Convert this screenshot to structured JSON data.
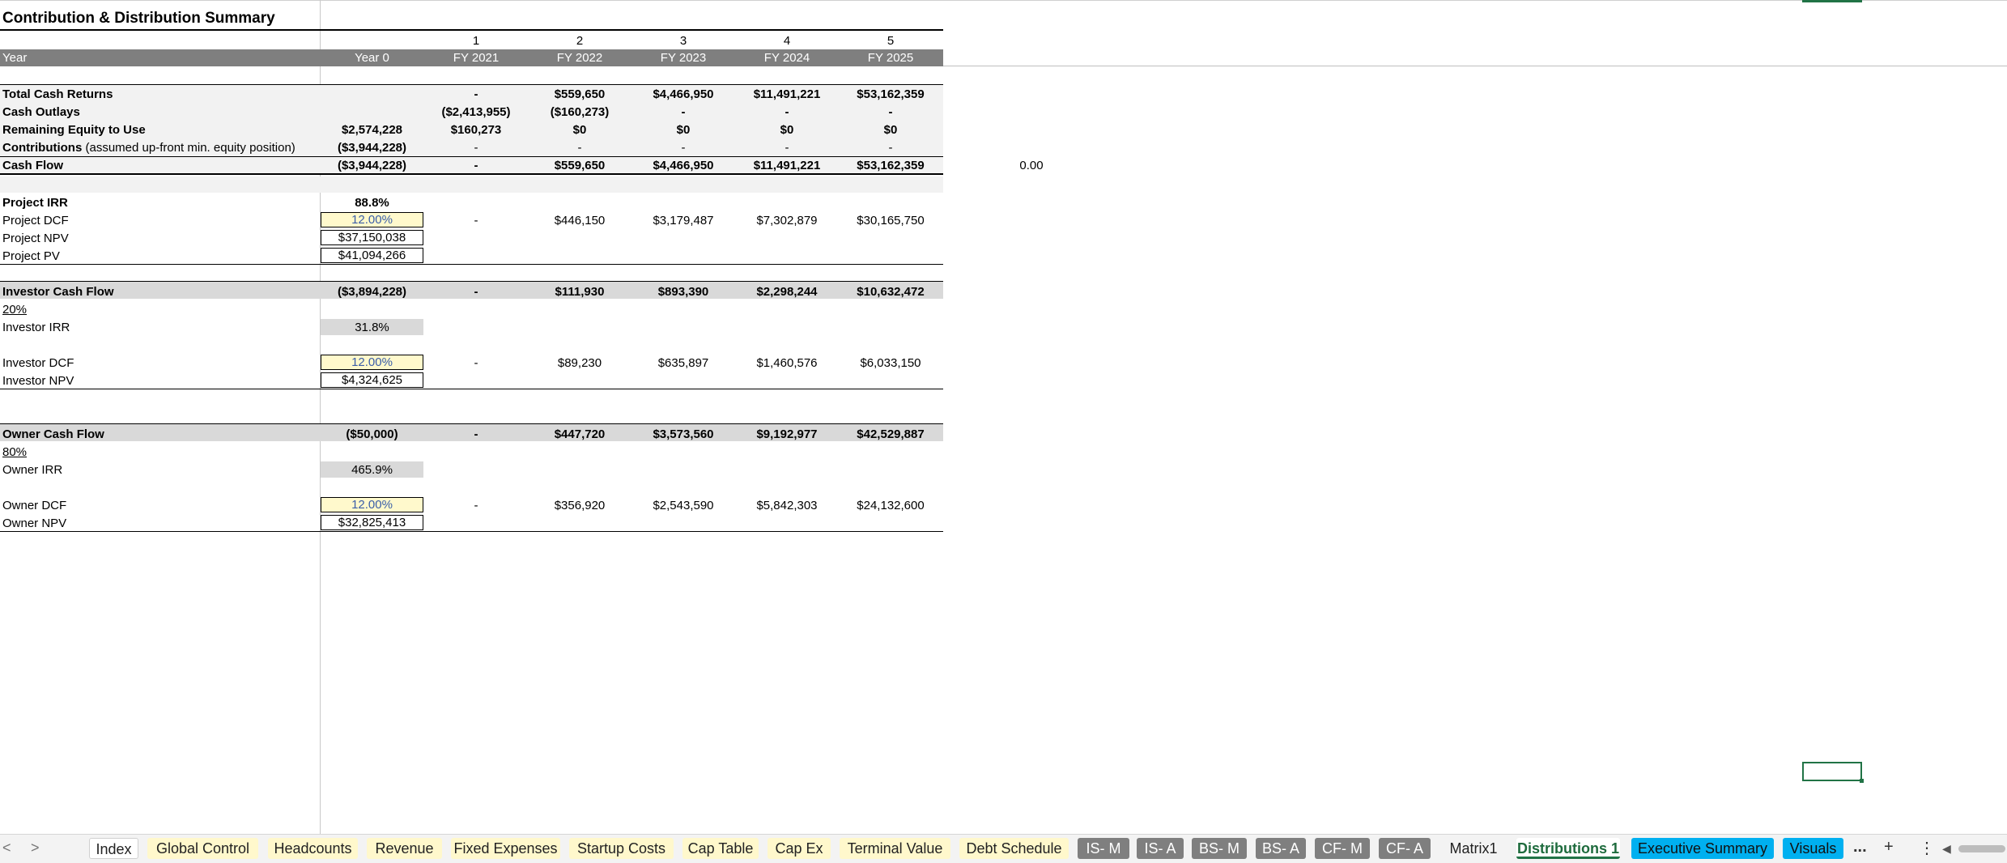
{
  "sheet": {
    "title": "Contribution & Distribution Summary",
    "period_numbers": [
      "1",
      "2",
      "3",
      "4",
      "5"
    ],
    "year_row": {
      "label": "Year",
      "values": [
        "Year 0",
        "FY 2021",
        "FY 2022",
        "FY 2023",
        "FY 2024",
        "FY 2025"
      ]
    },
    "summary_rows": [
      {
        "label": "Total Cash Returns",
        "values": [
          "",
          "-",
          "$559,650",
          "$4,466,950",
          "$11,491,221",
          "$53,162,359"
        ]
      },
      {
        "label": "Cash Outlays",
        "values": [
          "",
          "($2,413,955)",
          "($160,273)",
          "-",
          "-",
          "-"
        ]
      },
      {
        "label": "Remaining Equity to Use",
        "values": [
          "$2,574,228",
          "$160,273",
          "$0",
          "$0",
          "$0",
          "$0"
        ]
      },
      {
        "label": "Contributions",
        "label_suffix": " (assumed up-front min. equity position)",
        "values": [
          "($3,944,228)",
          "-",
          "-",
          "-",
          "-",
          "-"
        ]
      },
      {
        "label": "Cash Flow",
        "values": [
          "($3,944,228)",
          "-",
          "$559,650",
          "$4,466,950",
          "$11,491,221",
          "$53,162,359"
        ],
        "extra": "0.00"
      }
    ],
    "project": {
      "irr_label": "Project IRR",
      "irr": "88.8%",
      "dcf_label": "Project DCF",
      "dcf_rate": "12.00%",
      "dcf_values": [
        "-",
        "$446,150",
        "$3,179,487",
        "$7,302,879",
        "$30,165,750"
      ],
      "npv_label": "Project NPV",
      "npv": "$37,150,038",
      "pv_label": "Project PV",
      "pv": "$41,094,266"
    },
    "investor": {
      "cf_label": "Investor Cash Flow",
      "cf_values": [
        "($3,894,228)",
        "-",
        "$111,930",
        "$893,390",
        "$2,298,244",
        "$10,632,472"
      ],
      "share": "20%",
      "irr_label": "Investor IRR",
      "irr": "31.8%",
      "dcf_label": "Investor DCF",
      "dcf_rate": "12.00%",
      "dcf_values": [
        "-",
        "$89,230",
        "$635,897",
        "$1,460,576",
        "$6,033,150"
      ],
      "npv_label": "Investor NPV",
      "npv": "$4,324,625"
    },
    "owner": {
      "cf_label": "Owner Cash Flow",
      "cf_values": [
        "($50,000)",
        "-",
        "$447,720",
        "$3,573,560",
        "$9,192,977",
        "$42,529,887"
      ],
      "share": "80%",
      "irr_label": "Owner IRR",
      "irr": "465.9%",
      "dcf_label": "Owner DCF",
      "dcf_rate": "12.00%",
      "dcf_values": [
        "-",
        "$356,920",
        "$2,543,590",
        "$5,842,303",
        "$24,132,600"
      ],
      "npv_label": "Owner NPV",
      "npv": "$32,825,413"
    }
  },
  "tabs": {
    "items": [
      {
        "label": "Index"
      },
      {
        "label": "Global Control"
      },
      {
        "label": "Headcounts"
      },
      {
        "label": "Revenue"
      },
      {
        "label": "Fixed Expenses"
      },
      {
        "label": "Startup Costs"
      },
      {
        "label": "Cap Table"
      },
      {
        "label": "Cap Ex"
      },
      {
        "label": "Terminal Value"
      },
      {
        "label": "Debt Schedule"
      },
      {
        "label": "IS- M"
      },
      {
        "label": "IS- A"
      },
      {
        "label": "BS- M"
      },
      {
        "label": "BS- A"
      },
      {
        "label": "CF- M"
      },
      {
        "label": "CF- A"
      },
      {
        "label": "Matrix1"
      },
      {
        "label": "Distributions 1"
      },
      {
        "label": "Executive Summary"
      },
      {
        "label": "Visuals"
      }
    ],
    "nav_prev": "<",
    "nav_next": ">",
    "more": "...",
    "add": "+",
    "options": "⋮",
    "scroll_left": "◀"
  },
  "colors": {
    "tab_yellow": "#fff8cc",
    "tab_gray": "#7f7f7f",
    "tab_blue": "#00b0f0",
    "excel_green": "#217346",
    "header_band": "#7f7f7f"
  }
}
